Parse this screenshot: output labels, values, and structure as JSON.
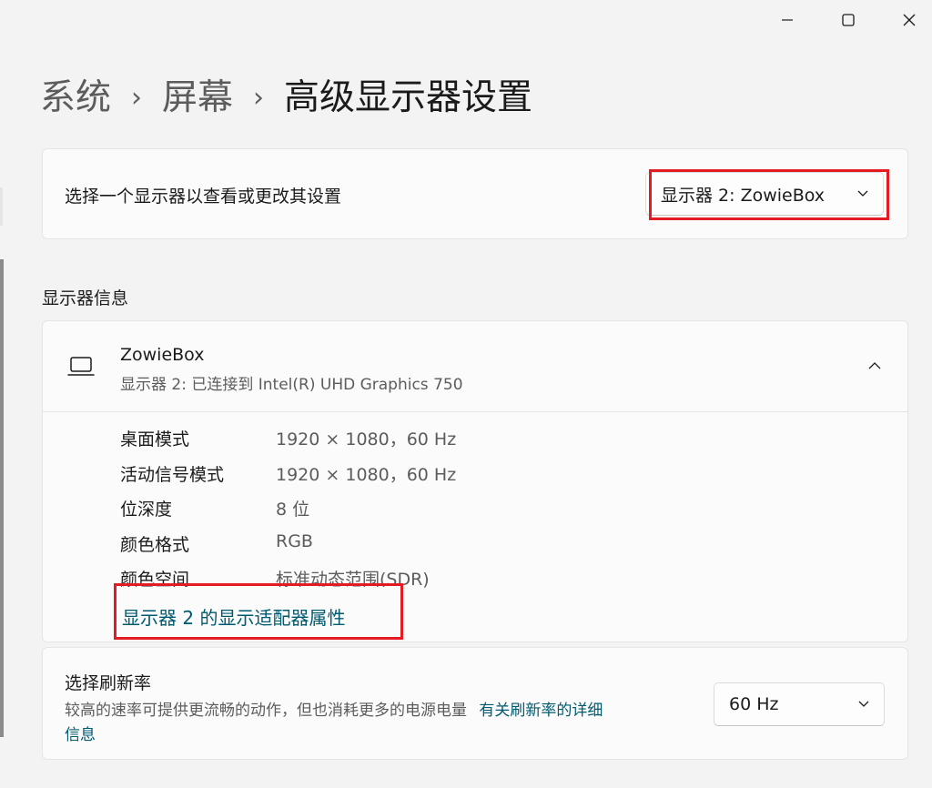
{
  "window": {
    "minimize_icon": "minimize-icon",
    "maximize_icon": "maximize-icon",
    "close_icon": "close-icon"
  },
  "breadcrumb": {
    "items": [
      "系统",
      "屏幕",
      "高级显示器设置"
    ],
    "separator": "›"
  },
  "monitor_select": {
    "label": "选择一个显示器以查看或更改其设置",
    "value": "显示器 2: ZowieBox"
  },
  "section_title": "显示器信息",
  "display": {
    "name": "ZowieBox",
    "subtitle": "显示器 2: 已连接到 Intel(R) UHD Graphics 750",
    "icon": "laptop-icon",
    "expanded": true,
    "properties": [
      {
        "key": "桌面模式",
        "value": "1920 × 1080，60 Hz"
      },
      {
        "key": "活动信号模式",
        "value": "1920 × 1080，60 Hz"
      },
      {
        "key": "位深度",
        "value": "8 位"
      },
      {
        "key": "颜色格式",
        "value": "RGB"
      },
      {
        "key": "颜色空间",
        "value": "标准动态范围(SDR)"
      }
    ],
    "adapter_link": "显示器 2 的显示适配器属性"
  },
  "refresh": {
    "title": "选择刷新率",
    "description": "较高的速率可提供更流畅的动作，但也消耗更多的电源电量",
    "link_line1": "有关刷新率的详细",
    "link_line2": "信息",
    "value": "60 Hz"
  },
  "colors": {
    "background": "#f3f3f3",
    "card": "#fbfbfb",
    "link": "#005a70",
    "highlight": "#e41b23"
  }
}
